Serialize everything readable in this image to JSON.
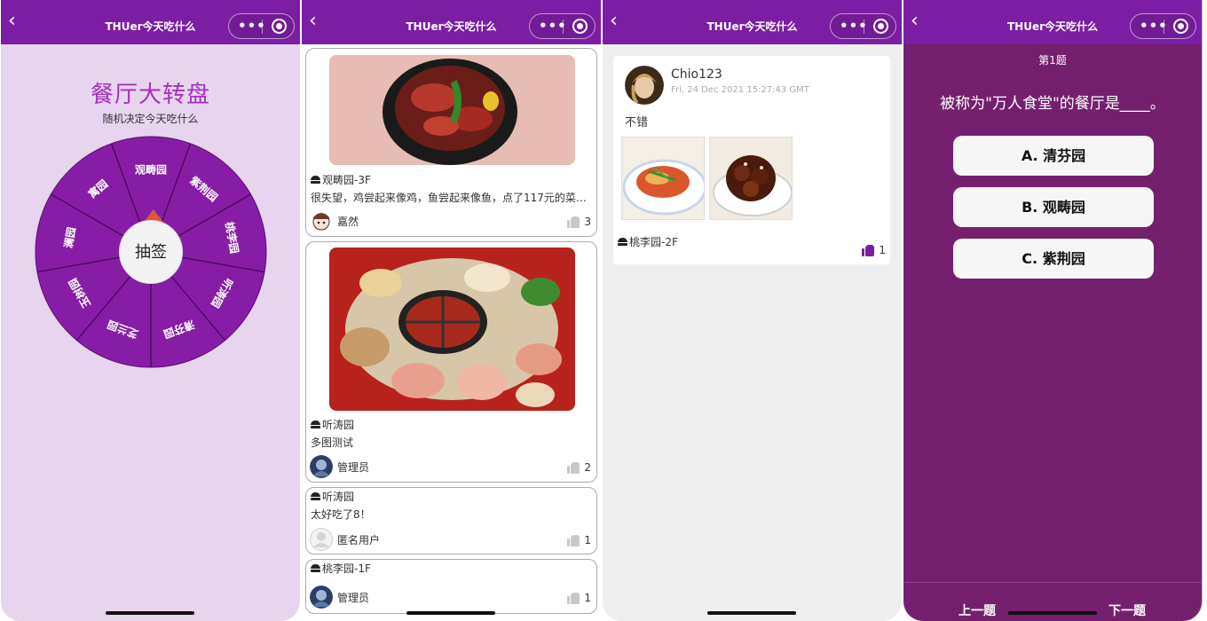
{
  "app": {
    "title": "THUer今天吃什么",
    "back_glyph": "‹",
    "menu_glyph": "•••"
  },
  "wheel": {
    "title": "餐厅大转盘",
    "subtitle": "随机决定今天吃什么",
    "button": "抽签",
    "segments": [
      "观畴园",
      "紫荆园",
      "桃李园",
      "听涛园",
      "清芬园",
      "芝兰园",
      "玉树园",
      "澜园",
      "寓园"
    ],
    "colors": {
      "segment": "#871da6",
      "line": "#3c0a52",
      "pointer": "#e0553d"
    }
  },
  "feed": {
    "cards": [
      {
        "location": "观畴园-3F",
        "text": "很失望，鸡尝起来像鸡，鱼尝起来像鱼，点了117元的菜…",
        "author": "嘉然",
        "likes": "3"
      },
      {
        "location": "听涛园",
        "text": "多图测试",
        "author": "管理员",
        "likes": "2"
      },
      {
        "location": "听涛园",
        "text": "太好吃了8！",
        "author": "匿名用户",
        "likes": "1"
      },
      {
        "location": "桃李园-1F",
        "text": "",
        "author": "管理员",
        "likes": "1"
      }
    ]
  },
  "detail": {
    "username": "Chio123",
    "timestamp": "Fri, 24 Dec 2021 15:27:43 GMT",
    "text": "不错",
    "location": "桃李园-2F",
    "likes": "1"
  },
  "quiz": {
    "number": "第1题",
    "question": "被称为\"万人食堂\"的餐厅是____。",
    "options": [
      "A. 清芬园",
      "B. 观畴园",
      "C. 紫荆园"
    ],
    "prev": "上一题",
    "next": "下一题"
  }
}
